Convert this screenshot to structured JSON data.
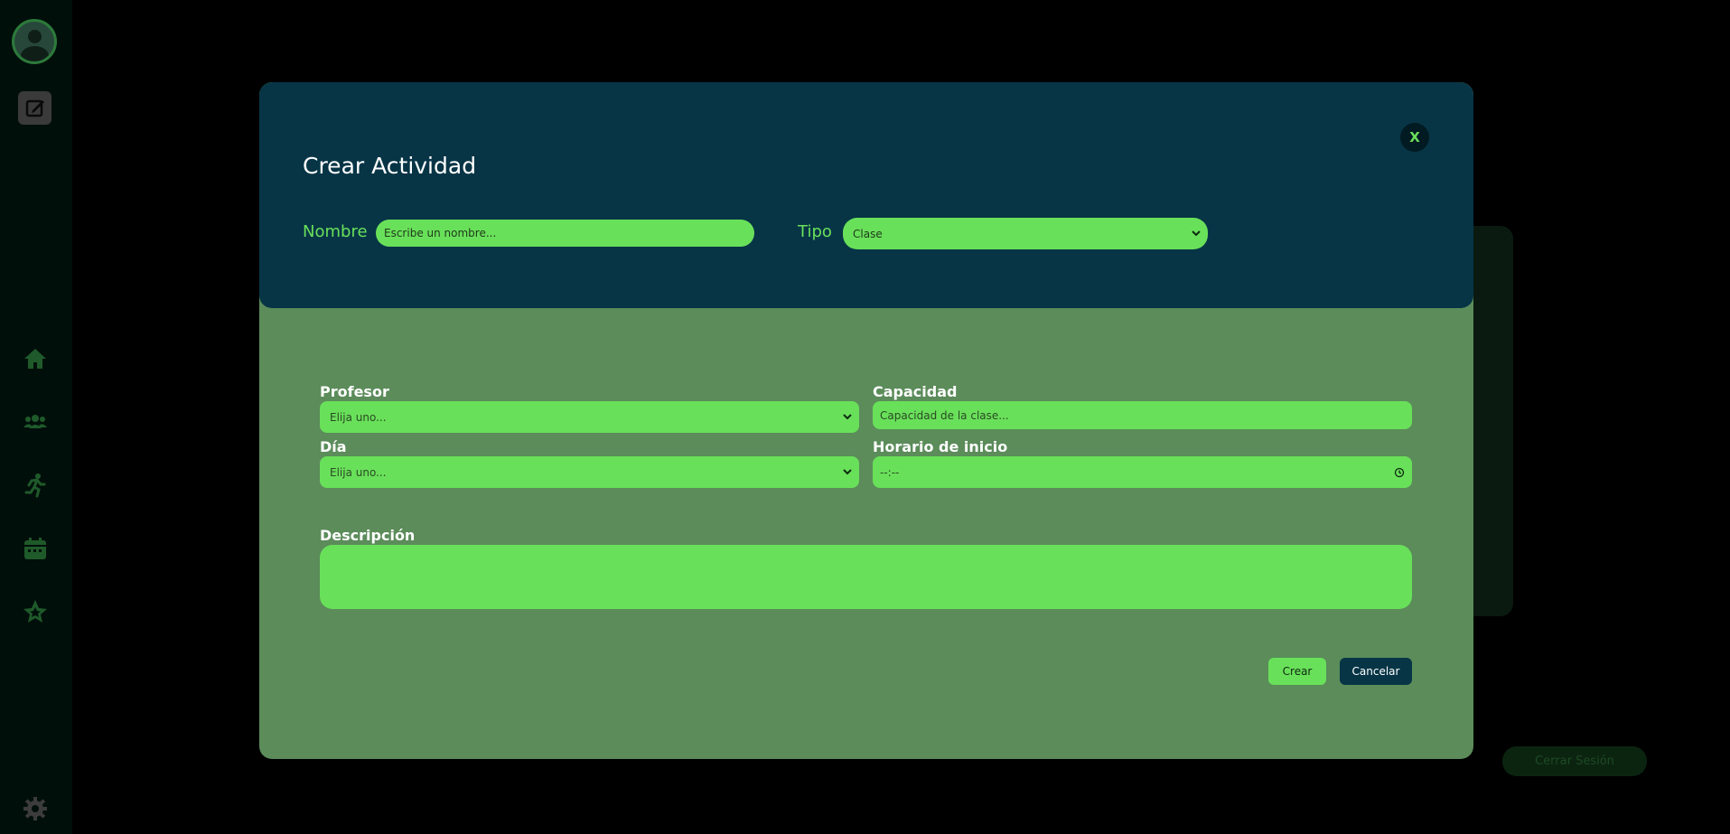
{
  "sidebar": {
    "icons": [
      "home-icon",
      "users-icon",
      "running-icon",
      "calendar-icon",
      "star-icon",
      "settings-icon"
    ]
  },
  "background": {
    "logout_label": "Cerrar Sesión"
  },
  "modal": {
    "title": "Crear Actividad",
    "close_label": "X",
    "nombre_label": "Nombre",
    "nombre_placeholder": "Escribe un nombre...",
    "tipo_label": "Tipo",
    "tipo_value": "Clase",
    "profesor_label": "Profesor",
    "profesor_value": "Elija uno...",
    "capacidad_label": "Capacidad",
    "capacidad_placeholder": "Capacidad de la clase...",
    "dia_label": "Día",
    "dia_value": "Elija uno...",
    "horario_label": "Horario de inicio",
    "horario_value": "--:--",
    "descripcion_label": "Descripción",
    "crear_label": "Crear",
    "cancelar_label": "Cancelar"
  },
  "colors": {
    "accent": "#69e05a",
    "header_bg": "#073546",
    "body_bg": "#5b8c5a"
  }
}
